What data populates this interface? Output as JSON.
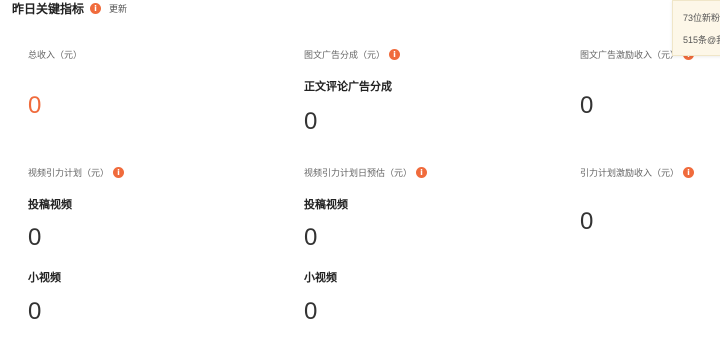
{
  "header": {
    "title": "昨日关键指标",
    "update_label": "更新"
  },
  "metrics": {
    "total_income": {
      "label": "总收入（元）",
      "value": "0"
    },
    "article_ad_share": {
      "label": "图文广告分成（元）",
      "sub_label": "正文评论广告分成",
      "value": "0"
    },
    "article_ad_incentive": {
      "label": "图文广告激励收入（元）",
      "value": "0"
    },
    "video_traffic_plan": {
      "label": "视频引力计划（元）",
      "sub1_label": "投稿视频",
      "sub1_value": "0",
      "sub2_label": "小视频",
      "sub2_value": "0"
    },
    "video_traffic_estimate": {
      "label": "视频引力计划日预估（元）",
      "sub1_label": "投稿视频",
      "sub1_value": "0",
      "sub2_label": "小视频",
      "sub2_value": "0"
    },
    "traffic_incentive": {
      "label": "引力计划激励收入（元）",
      "value": "0"
    }
  },
  "popup": {
    "line1": "73位新粉",
    "line2": "515条@我"
  },
  "colors": {
    "accent": "#f06b3c",
    "popup_bg": "#fdf7e8"
  }
}
